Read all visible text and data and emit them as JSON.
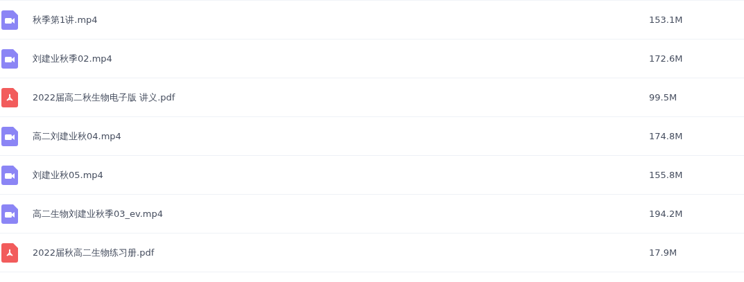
{
  "files": [
    {
      "kind": "video",
      "name": "秋季第1讲.mp4",
      "size": "153.1M"
    },
    {
      "kind": "video",
      "name": "刘建业秋季02.mp4",
      "size": "172.6M"
    },
    {
      "kind": "pdf",
      "name": "2022届高二秋生物电子版 讲义.pdf",
      "size": "99.5M"
    },
    {
      "kind": "video",
      "name": "高二刘建业秋04.mp4",
      "size": "174.8M"
    },
    {
      "kind": "video",
      "name": "刘建业秋05.mp4",
      "size": "155.8M"
    },
    {
      "kind": "video",
      "name": "高二生物刘建业秋季03_ev.mp4",
      "size": "194.2M"
    },
    {
      "kind": "pdf",
      "name": "2022届秋高二生物练习册.pdf",
      "size": "17.9M"
    }
  ]
}
